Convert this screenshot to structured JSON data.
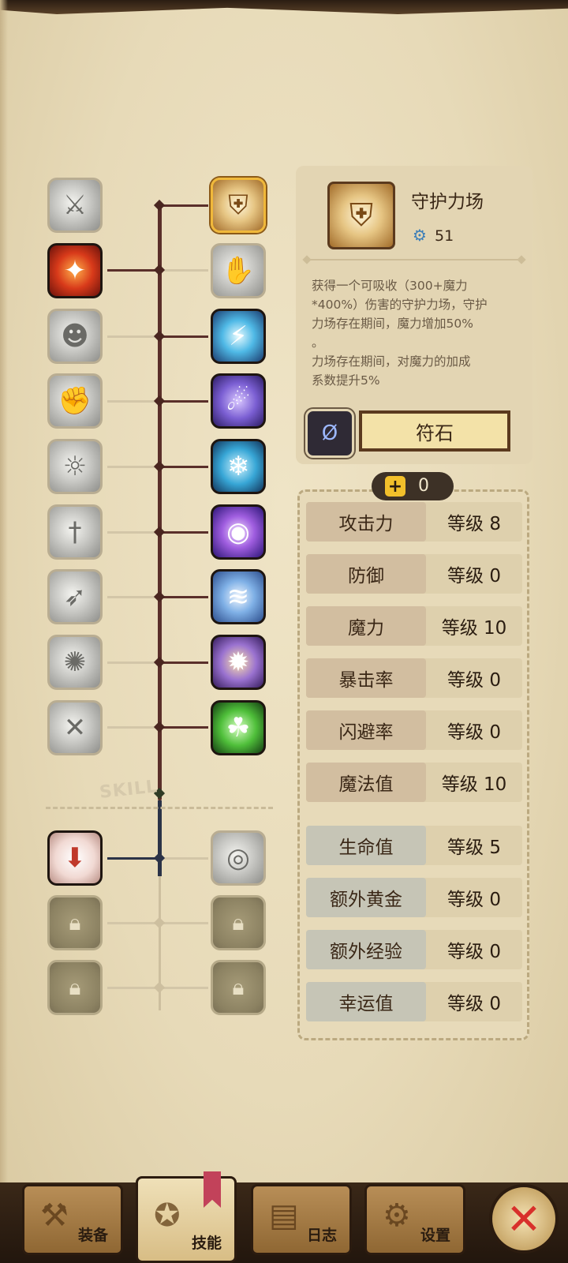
{
  "skill_tree": {
    "watermark": "SKILL",
    "left_column": [
      {
        "id": "slash",
        "icon": "slash-icon",
        "state": "locked-gray"
      },
      {
        "id": "fire-strike",
        "icon": "fire-strike-icon",
        "state": "active"
      },
      {
        "id": "roar",
        "icon": "roar-icon",
        "state": "locked-gray"
      },
      {
        "id": "muscle",
        "icon": "muscle-icon",
        "state": "locked-gray"
      },
      {
        "id": "whirlwind",
        "icon": "whirlwind-icon",
        "state": "locked-gray"
      },
      {
        "id": "sword-thrust",
        "icon": "sword-thrust-icon",
        "state": "locked-gray"
      },
      {
        "id": "dash",
        "icon": "dash-icon",
        "state": "locked-gray"
      },
      {
        "id": "berserk",
        "icon": "berserk-icon",
        "state": "locked-gray"
      },
      {
        "id": "cross-swords",
        "icon": "cross-swords-icon",
        "state": "locked-gray"
      }
    ],
    "right_column": [
      {
        "id": "guardian-field",
        "icon": "shield-icon",
        "state": "selected"
      },
      {
        "id": "stone-fist",
        "icon": "stone-fist-icon",
        "state": "locked-gray"
      },
      {
        "id": "lightning",
        "icon": "lightning-icon",
        "state": "active"
      },
      {
        "id": "shadow-dash",
        "icon": "shadow-dash-icon",
        "state": "active"
      },
      {
        "id": "ice-burst",
        "icon": "ice-burst-icon",
        "state": "active"
      },
      {
        "id": "void-eye",
        "icon": "eye-icon",
        "state": "active"
      },
      {
        "id": "wind-blade",
        "icon": "wind-blade-icon",
        "state": "active"
      },
      {
        "id": "arcane-vortex",
        "icon": "vortex-icon",
        "state": "active"
      },
      {
        "id": "clover-heal",
        "icon": "clover-icon",
        "state": "active"
      }
    ],
    "bottom_left": [
      {
        "id": "trophy",
        "icon": "trophy-icon",
        "state": "active"
      },
      {
        "id": "locked-1",
        "icon": "lock-icon",
        "state": "locked"
      },
      {
        "id": "locked-2",
        "icon": "lock-icon",
        "state": "locked"
      }
    ],
    "bottom_right": [
      {
        "id": "eye-trophy",
        "icon": "eye-trophy-icon",
        "state": "locked-gray"
      },
      {
        "id": "locked-3",
        "icon": "lock-icon",
        "state": "locked"
      },
      {
        "id": "locked-4",
        "icon": "lock-icon",
        "state": "locked"
      }
    ]
  },
  "detail": {
    "name": "守护力场",
    "points": "51",
    "description": "获得一个可吸收（300+魔力\n*400%）伤害的守护力场，守护\n力场存在期间，魔力增加50%\n。\n力场存在期间，对魔力的加成\n系数提升5%",
    "rune_button": "符石"
  },
  "stats": {
    "available_points": "0",
    "rows": [
      {
        "label": "攻击力",
        "level": "等级 8",
        "tone": "warm"
      },
      {
        "label": "防御",
        "level": "等级 0",
        "tone": "warm"
      },
      {
        "label": "魔力",
        "level": "等级 10",
        "tone": "warm"
      },
      {
        "label": "暴击率",
        "level": "等级 0",
        "tone": "warm"
      },
      {
        "label": "闪避率",
        "level": "等级 0",
        "tone": "warm"
      },
      {
        "label": "魔法值",
        "level": "等级 10",
        "tone": "warm"
      },
      {
        "label": "生命值",
        "level": "等级 5",
        "tone": "cool"
      },
      {
        "label": "额外黄金",
        "level": "等级 0",
        "tone": "cool"
      },
      {
        "label": "额外经验",
        "level": "等级 0",
        "tone": "cool"
      },
      {
        "label": "幸运值",
        "level": "等级 0",
        "tone": "cool"
      }
    ]
  },
  "nav": {
    "equipment": "装备",
    "skills": "技能",
    "log": "日志",
    "settings": "设置"
  }
}
